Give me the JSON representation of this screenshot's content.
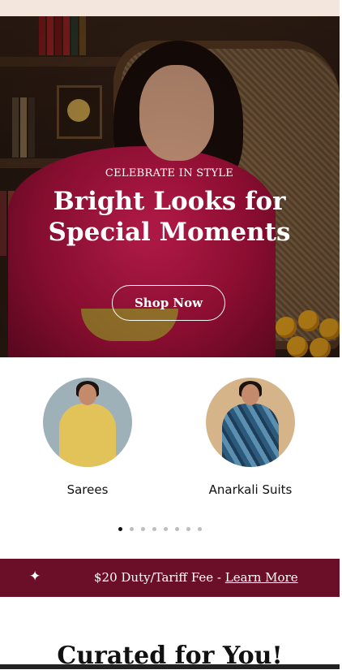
{
  "hero": {
    "eyebrow": "CELEBRATE IN STYLE",
    "title_line1": "Bright Looks for",
    "title_line2": "Special Moments",
    "cta_label": "Shop Now"
  },
  "categories": [
    {
      "label": "Sarees",
      "icon": "saree-model-image"
    },
    {
      "label": "Anarkali Suits",
      "icon": "anarkali-model-image"
    }
  ],
  "carousel": {
    "total_dots": 8,
    "active_index": 0
  },
  "announcement": {
    "icon": "sparkle-icon",
    "text": "$20 Duty/Tariff Fee - ",
    "link": "Learn More"
  },
  "section_title": "Curated for You!",
  "colors": {
    "announcement_bg": "#6a0f27",
    "top_bar": "#f3e6dc"
  }
}
